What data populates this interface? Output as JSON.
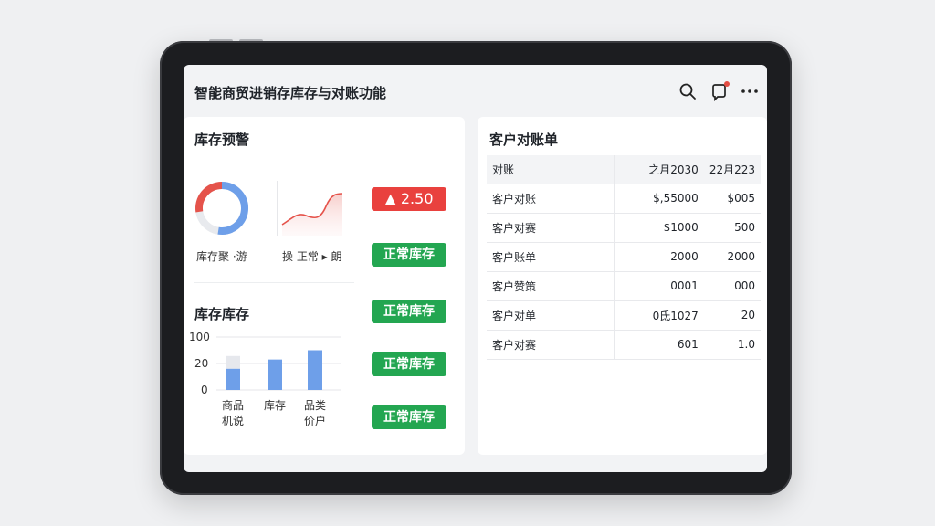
{
  "app": {
    "title": "智能商贸进销存库存与对账功能"
  },
  "inventory_alert": {
    "title": "库存预警",
    "donut_caption": "库存聚 ·游",
    "trend_caption": "操 正常 ▸ 朗",
    "alert_badge": "▲ 2.50",
    "status_badge": "正常库存",
    "colors": {
      "donut_blue": "#6e9fe9",
      "donut_red": "#e5534b",
      "donut_track": "#e8eaee",
      "line_red": "#e5534b"
    }
  },
  "inventory_stock": {
    "title": "库存库存",
    "status_badges": [
      "正常库存",
      "正常库存",
      "正常库存"
    ],
    "chart_data": {
      "type": "bar",
      "categories": [
        "商品\n机说",
        "库存",
        "品类\n价户"
      ],
      "series": [
        {
          "values": [
            16,
            23,
            30
          ]
        }
      ],
      "yticks": [
        "100",
        "20",
        "0"
      ],
      "grid": true,
      "colors": {
        "bar": "#6e9fe9",
        "ghost": "#e6e8ed"
      }
    }
  },
  "reconciliation": {
    "title": "客户对账单",
    "header": [
      "对账",
      "之月2030",
      "22月223"
    ],
    "rows": [
      [
        "客户对账",
        "$,55000",
        "$005"
      ],
      [
        "客户对赛",
        "$1000",
        "500"
      ],
      [
        "客户账单",
        "2000",
        "2000"
      ],
      [
        "客户赞策",
        "0001",
        "000"
      ],
      [
        "客户对单",
        "0氐1027",
        "20"
      ],
      [
        "客户对赛",
        "601",
        "1.0"
      ]
    ]
  },
  "colors": {
    "page_bg": "#eff0f2",
    "device": "#1c1d20",
    "screen_bg": "#f2f3f5",
    "green": "#23a651",
    "red": "#e9413e"
  }
}
